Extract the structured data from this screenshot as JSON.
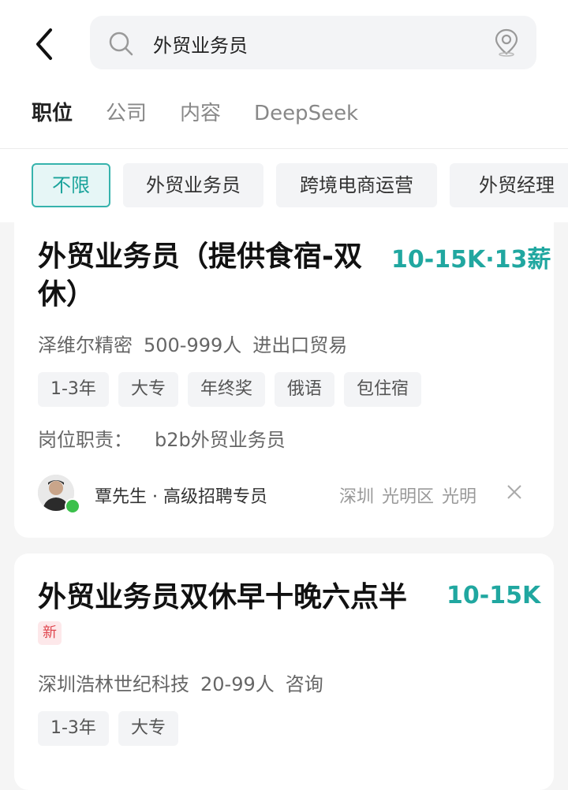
{
  "search": {
    "query": "外贸业务员"
  },
  "icons": {
    "back": "back-arrow-icon",
    "search": "search-icon",
    "location": "location-pin-icon",
    "close": "close-icon"
  },
  "tabs": [
    {
      "label": "职位",
      "active": true
    },
    {
      "label": "公司"
    },
    {
      "label": "内容"
    },
    {
      "label": "DeepSeek"
    }
  ],
  "filters": [
    {
      "label": "不限",
      "active": true
    },
    {
      "label": "外贸业务员"
    },
    {
      "label": "跨境电商运营"
    },
    {
      "label": "外贸经理"
    }
  ],
  "jobs": [
    {
      "title_line1": "外贸业务员（提供食宿-双",
      "title_line2": "休）",
      "salary": "10-15K·13薪",
      "company": {
        "name": "泽维尔精密",
        "size": "500-999人",
        "industry": "进出口贸易"
      },
      "tags": [
        "1-3年",
        "大专",
        "年终奖",
        "俄语",
        "包住宿"
      ],
      "duty_label": "岗位职责：",
      "duty_text": "b2b外贸业务员",
      "recruiter": {
        "name": "覃先生 · 高级招聘专员",
        "online": true
      },
      "location": {
        "city": "深圳",
        "district": "光明区",
        "area": "光明"
      }
    },
    {
      "title_line1": "外贸业务员双休早十晚六点半",
      "salary": "10-15K",
      "badge": "新",
      "company": {
        "name": "深圳浩林世纪科技",
        "size": "20-99人",
        "industry": "咨询"
      },
      "tags": [
        "1-3年",
        "大专"
      ]
    }
  ],
  "colors": {
    "accent": "#20a7a0",
    "chip_active_bg": "#e6f6f6",
    "badge_new": "#e0474f",
    "online": "#3bc04b"
  }
}
